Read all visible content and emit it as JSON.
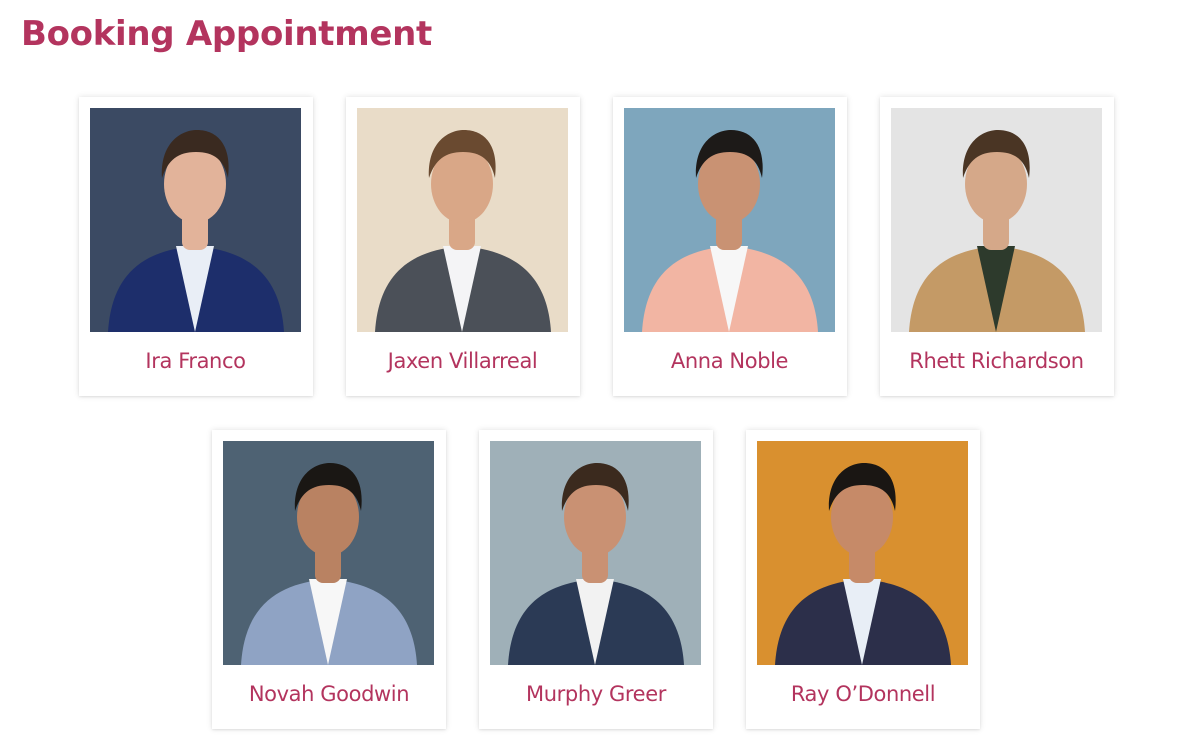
{
  "header": {
    "title": "Booking Appointment"
  },
  "doctors": [
    {
      "name": "Ira Franco",
      "bg": "#3b4a63",
      "skin": "#e2b39a",
      "hair": "#3a2a20",
      "jacket": "#1d2e6b",
      "shirt": "#e9eef6"
    },
    {
      "name": "Jaxen Villarreal",
      "bg": "#e9dcc8",
      "skin": "#d9a787",
      "hair": "#6a4a30",
      "jacket": "#4b5058",
      "shirt": "#f4f4f6"
    },
    {
      "name": "Anna Noble",
      "bg": "#7ea6bd",
      "skin": "#c99273",
      "hair": "#1d1a18",
      "jacket": "#f2b5a3",
      "shirt": "#f7f7f7"
    },
    {
      "name": "Rhett Richardson",
      "bg": "#e4e4e4",
      "skin": "#d5a889",
      "hair": "#4a3524",
      "jacket": "#c49a66",
      "shirt": "#2d3a2c"
    },
    {
      "name": "Novah Goodwin",
      "bg": "#4e6273",
      "skin": "#b98262",
      "hair": "#1a1714",
      "jacket": "#8fa3c4",
      "shirt": "#f7f7f7"
    },
    {
      "name": "Murphy Greer",
      "bg": "#9fb0b8",
      "skin": "#c99173",
      "hair": "#3b2a1e",
      "jacket": "#2b3a55",
      "shirt": "#f2f2f2"
    },
    {
      "name": "Ray O’Donnell",
      "bg": "#d9902f",
      "skin": "#c68a68",
      "hair": "#1a1613",
      "jacket": "#2c2f4a",
      "shirt": "#e8eef6"
    }
  ]
}
